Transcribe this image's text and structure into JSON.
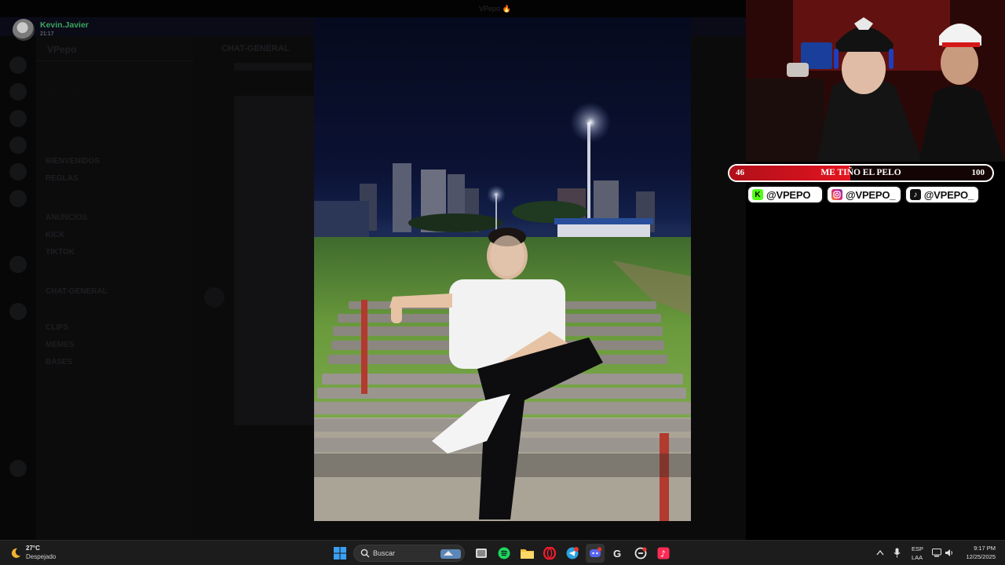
{
  "viewer": {
    "window_title": "VPepo 🔥",
    "author": "Kevin.Javier",
    "time": "21:17"
  },
  "discord": {
    "server_name": "VPepo",
    "chat_title": "CHAT-GENERAL",
    "channels": [
      {
        "label": "BIENVENIDOS",
        "kind": "channel"
      },
      {
        "label": "REGLAS",
        "kind": "channel"
      },
      {
        "label": "ANUNCIOS",
        "kind": "channel"
      },
      {
        "label": "KICK",
        "kind": "channel"
      },
      {
        "label": "TIKTOK",
        "kind": "channel"
      },
      {
        "label": "CHAT-GENERAL",
        "kind": "channel"
      },
      {
        "label": "CLIPS",
        "kind": "channel"
      },
      {
        "label": "MEMES",
        "kind": "channel"
      },
      {
        "label": "BASES",
        "kind": "channel"
      }
    ]
  },
  "stream_overlay": {
    "goal": {
      "current": "46",
      "label": "ME TIÑO EL PELO",
      "target": "100",
      "progress": 0.46,
      "color": "#e3141f"
    },
    "socials": [
      {
        "platform": "kick",
        "handle": "@VPEPO",
        "color": "#53fc18",
        "icon": "kick-icon"
      },
      {
        "platform": "instagram",
        "handle": "@VPEPO_",
        "color": "#e1306c",
        "icon": "instagram-icon"
      },
      {
        "platform": "tiktok",
        "handle": "@VPEPO_",
        "color": "#111111",
        "icon": "tiktok-icon"
      }
    ]
  },
  "taskbar": {
    "weather_temp": "27°C",
    "weather_desc": "Despejado",
    "search_placeholder": "Buscar",
    "lang_line1": "ESP",
    "lang_line2": "LAA",
    "time": "9:17 PM",
    "date": "12/25/2025",
    "apps": [
      "windows-start-icon",
      "task-view-icon",
      "spotify-icon",
      "file-explorer-icon",
      "opera-icon",
      "telegram-icon",
      "discord-icon",
      "steam-icon",
      "capcut-icon",
      "tiktok-icon"
    ]
  }
}
